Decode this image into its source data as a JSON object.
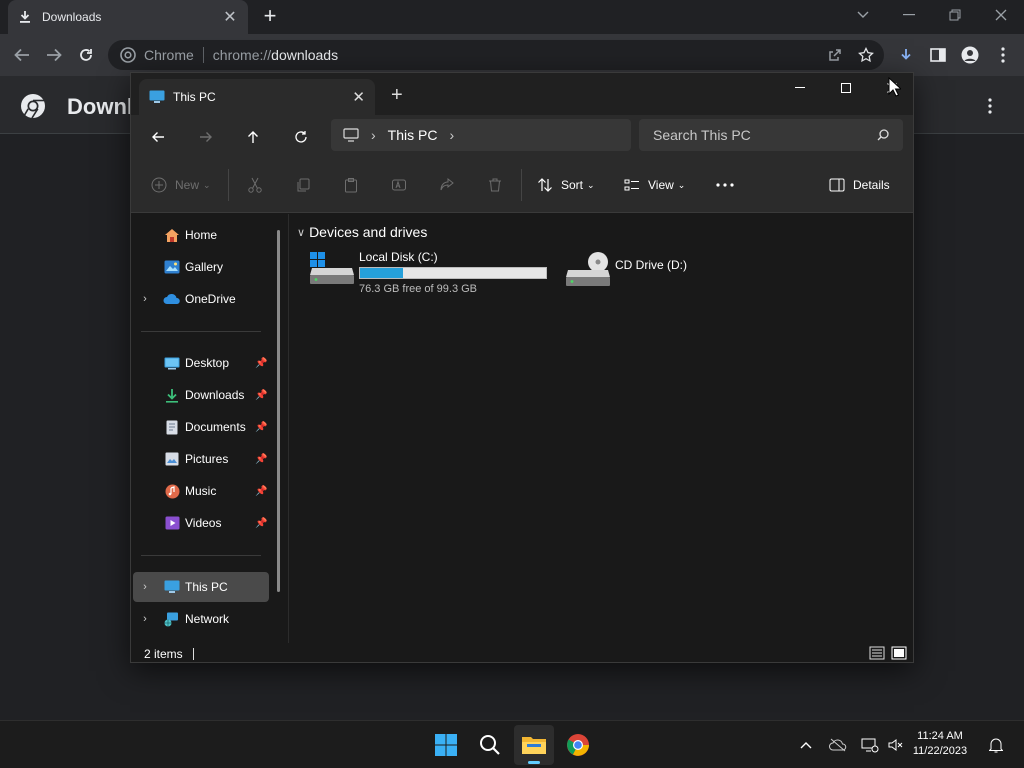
{
  "chrome": {
    "tab_title": "Downloads",
    "site_chip": "Chrome",
    "url_scheme": "chrome://",
    "url_path": "downloads",
    "page_title": "Downloads"
  },
  "explorer": {
    "tab_title": "This PC",
    "breadcrumb": [
      "This PC"
    ],
    "search_placeholder": "Search This PC",
    "commands": {
      "new": "New",
      "sort": "Sort",
      "view": "View",
      "details": "Details"
    },
    "sidebar": {
      "quick": [
        {
          "label": "Home",
          "icon": "home-icon"
        },
        {
          "label": "Gallery",
          "icon": "gallery-icon"
        },
        {
          "label": "OneDrive",
          "icon": "onedrive-icon"
        }
      ],
      "pinned": [
        {
          "label": "Desktop",
          "icon": "desktop-folder-icon"
        },
        {
          "label": "Downloads",
          "icon": "downloads-folder-icon"
        },
        {
          "label": "Documents",
          "icon": "documents-folder-icon"
        },
        {
          "label": "Pictures",
          "icon": "pictures-folder-icon"
        },
        {
          "label": "Music",
          "icon": "music-folder-icon"
        },
        {
          "label": "Videos",
          "icon": "videos-folder-icon"
        }
      ],
      "locations": [
        {
          "label": "This PC",
          "icon": "computer-icon"
        },
        {
          "label": "Network",
          "icon": "network-icon"
        }
      ]
    },
    "group_title": "Devices and drives",
    "drives": [
      {
        "label": "Local Disk (C:)",
        "free_text": "76.3 GB free of 99.3 GB",
        "used_fraction": 0.232,
        "icon": "local-disk-icon"
      },
      {
        "label": "CD Drive (D:)",
        "icon": "cd-drive-icon"
      }
    ],
    "status": "2 items"
  },
  "taskbar": {
    "time": "11:24 AM",
    "date": "11/22/2023"
  },
  "colors": {
    "accent": "#26a0da",
    "taskbar_indicator": "#60cdff",
    "chrome_toolbar": "#35363a",
    "explorer_bg": "#191919"
  }
}
